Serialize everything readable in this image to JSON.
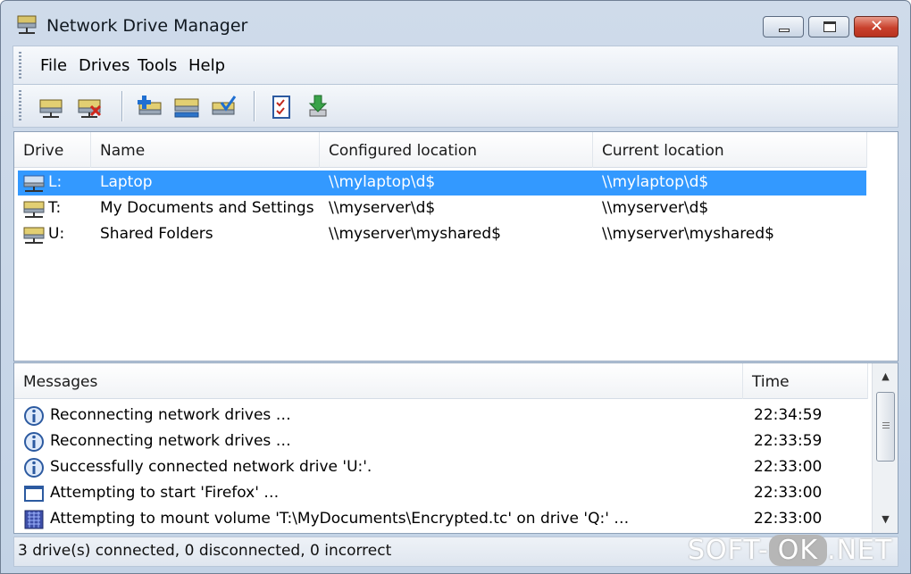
{
  "window": {
    "title": "Network Drive Manager"
  },
  "menu": [
    "File",
    "Drives",
    "Tools",
    "Help"
  ],
  "toolbar": {
    "buttons": [
      "connect-drive-icon",
      "disconnect-drive-icon",
      "add-drive-icon",
      "edit-drive-icon",
      "check-drive-icon",
      "options-icon",
      "download-icon"
    ]
  },
  "drives": {
    "columns": [
      "Drive",
      "Name",
      "Configured location",
      "Current location"
    ],
    "rows": [
      {
        "drive": "L:",
        "name": "Laptop",
        "configured": "\\\\mylaptop\\d$",
        "current": "\\\\mylaptop\\d$",
        "selected": true
      },
      {
        "drive": "T:",
        "name": "My Documents and Settings",
        "configured": "\\\\myserver\\d$",
        "current": "\\\\myserver\\d$",
        "selected": false
      },
      {
        "drive": "U:",
        "name": "Shared Folders",
        "configured": "\\\\myserver\\myshared$",
        "current": "\\\\myserver\\myshared$",
        "selected": false
      }
    ]
  },
  "messages": {
    "columns": [
      "Messages",
      "Time"
    ],
    "rows": [
      {
        "icon": "info-icon",
        "text": "Reconnecting network drives …",
        "time": "22:34:59"
      },
      {
        "icon": "info-icon",
        "text": "Reconnecting network drives …",
        "time": "22:33:59"
      },
      {
        "icon": "info-icon",
        "text": "Successfully connected network drive 'U:'.",
        "time": "22:33:00"
      },
      {
        "icon": "program-icon",
        "text": "Attempting to start 'Firefox' …",
        "time": "22:33:00"
      },
      {
        "icon": "volume-icon",
        "text": "Attempting to mount volume 'T:\\MyDocuments\\Encrypted.tc' on drive 'Q:' …",
        "time": "22:33:00"
      }
    ]
  },
  "status": {
    "text": "3 drive(s) connected,  0 disconnected,  0 incorrect"
  },
  "watermark": {
    "left": "SOFT-",
    "ok": "OK",
    "right": ".NET"
  }
}
